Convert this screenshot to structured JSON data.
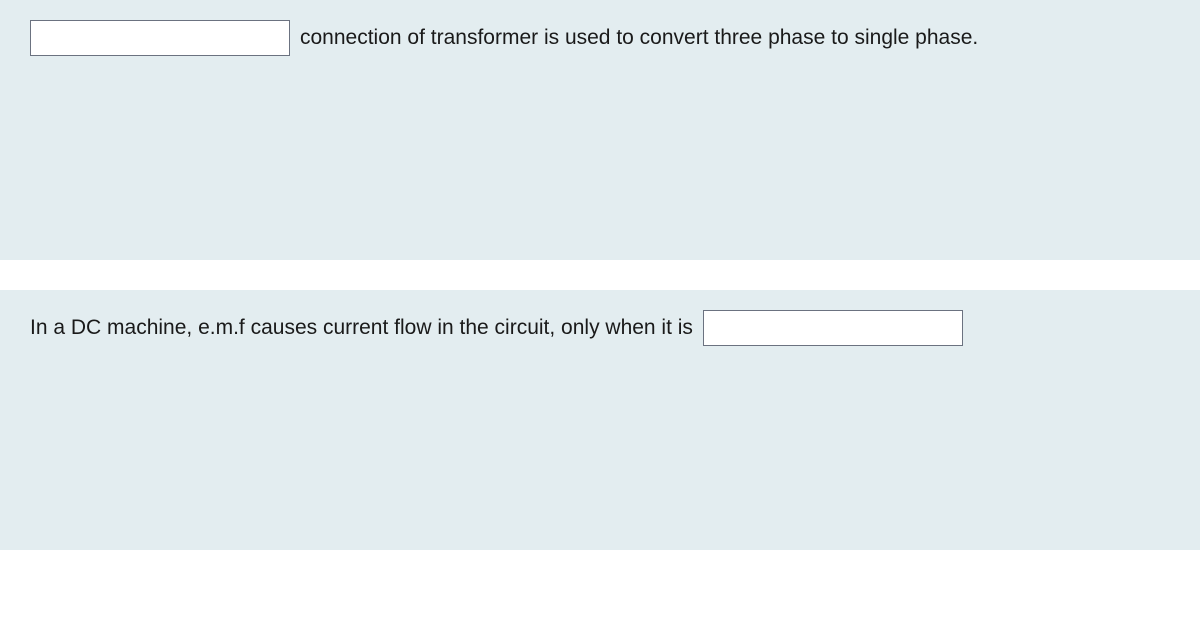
{
  "questions": [
    {
      "text_after": "connection of transformer is used to convert three phase to single phase.",
      "input_value": ""
    },
    {
      "text_before": "In a DC machine, e.m.f causes current flow in the circuit, only when it is",
      "input_value": ""
    }
  ]
}
